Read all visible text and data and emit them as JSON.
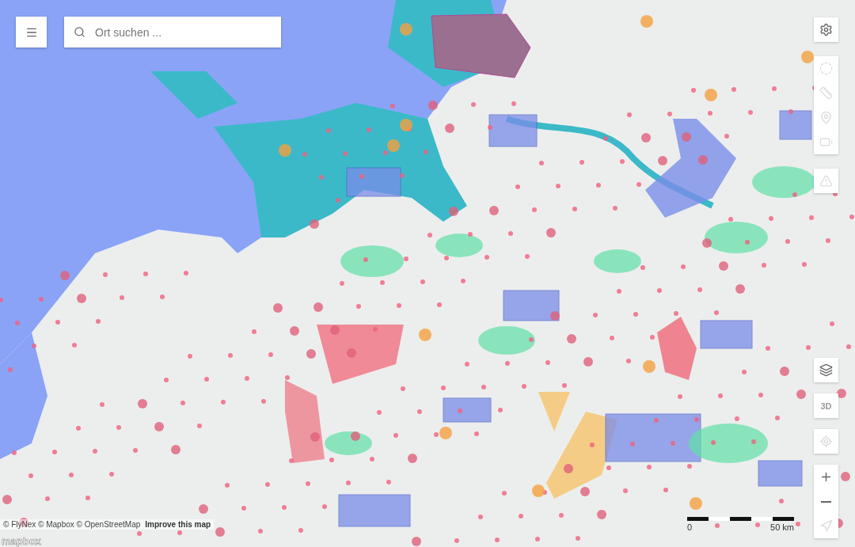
{
  "search": {
    "placeholder": "Ort suchen ..."
  },
  "top_controls": [
    {
      "buttons": [
        {
          "kind": "settings",
          "disabled": false
        }
      ]
    },
    {
      "buttons": [
        {
          "kind": "circle",
          "disabled": true
        },
        {
          "kind": "ruler",
          "disabled": true
        },
        {
          "kind": "pin",
          "disabled": true
        },
        {
          "kind": "battery",
          "disabled": true
        }
      ]
    },
    {
      "buttons": [
        {
          "kind": "warning",
          "disabled": true
        }
      ]
    }
  ],
  "bottom_controls": [
    {
      "buttons": [
        {
          "kind": "layers",
          "disabled": false
        }
      ]
    },
    {
      "buttons": [
        {
          "kind": "text",
          "label": "3D",
          "disabled": true
        }
      ]
    },
    {
      "buttons": [
        {
          "kind": "locate",
          "disabled": true
        }
      ]
    },
    {
      "buttons": [
        {
          "kind": "zoom_in",
          "disabled": false
        },
        {
          "kind": "zoom_out",
          "disabled": false
        },
        {
          "kind": "compass",
          "disabled": true
        }
      ]
    }
  ],
  "scale": {
    "start": "0",
    "end": "50 km"
  },
  "attribution": {
    "text": "© FlyNex © Mapbox © OpenStreetMap",
    "link": "Improve this map"
  },
  "logo": "mapbox"
}
